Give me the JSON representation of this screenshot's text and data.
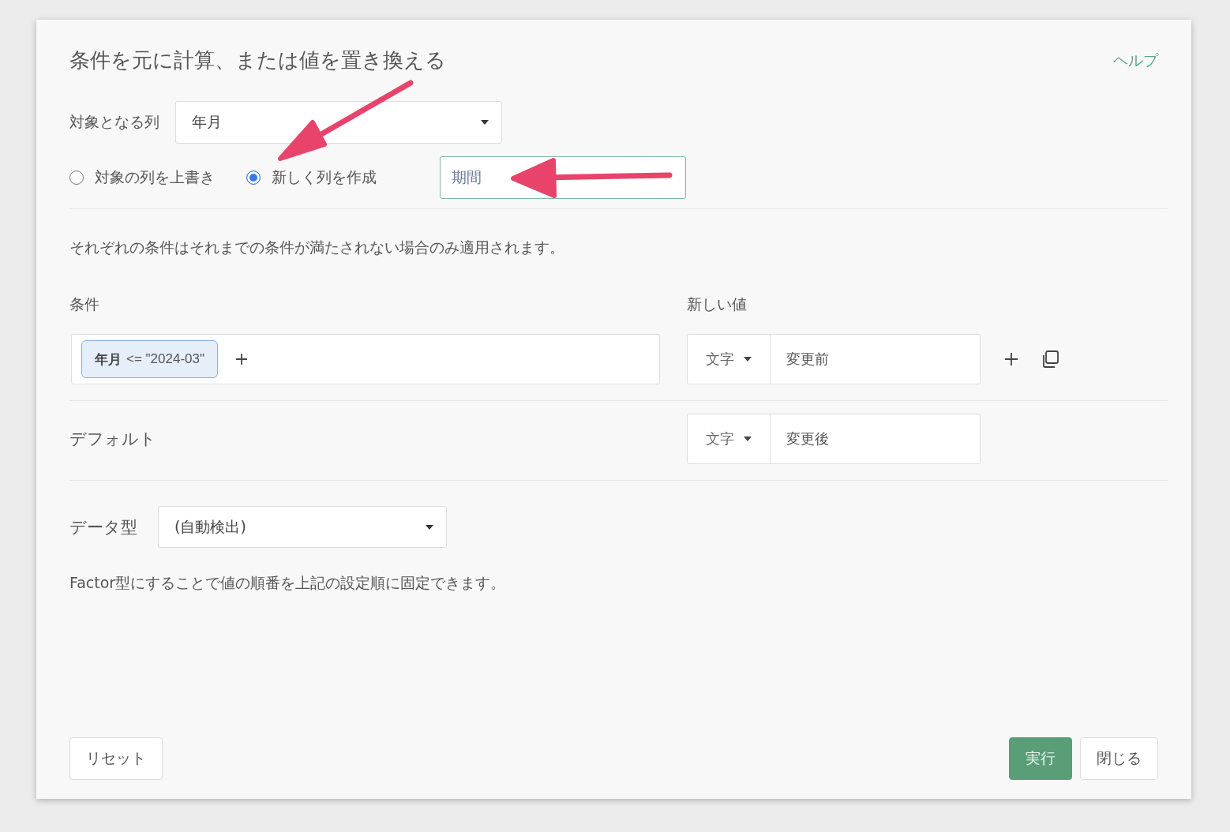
{
  "dialog": {
    "title": "条件を元に計算、または値を置き換える",
    "help_link": "ヘルプ",
    "target_column": {
      "label": "対象となる列",
      "value": "年月"
    },
    "output_mode": [
      {
        "label": "対象の列を上書き",
        "selected": false
      },
      {
        "label": "新しく列を作成",
        "selected": true
      }
    ],
    "new_column_name": {
      "value": "期間"
    },
    "info": "それぞれの条件はそれまでの条件が満たされない場合のみ適用されます。",
    "conditions_header": "条件",
    "new_value_header": "新しい値",
    "rules": [
      {
        "condition": {
          "column": "年月",
          "expression": "<= \"2024-03\""
        },
        "value_type": "文字",
        "value": "変更前"
      }
    ],
    "default": {
      "label": "デフォルト",
      "value_type": "文字",
      "value": "変更後"
    },
    "data_type": {
      "label": "データ型",
      "value": "(自動検出)"
    },
    "note": "Factor型にすることで値の順番を上記の設定順に固定できます。",
    "buttons": {
      "reset": "リセット",
      "run": "実行",
      "close": "閉じる"
    }
  }
}
